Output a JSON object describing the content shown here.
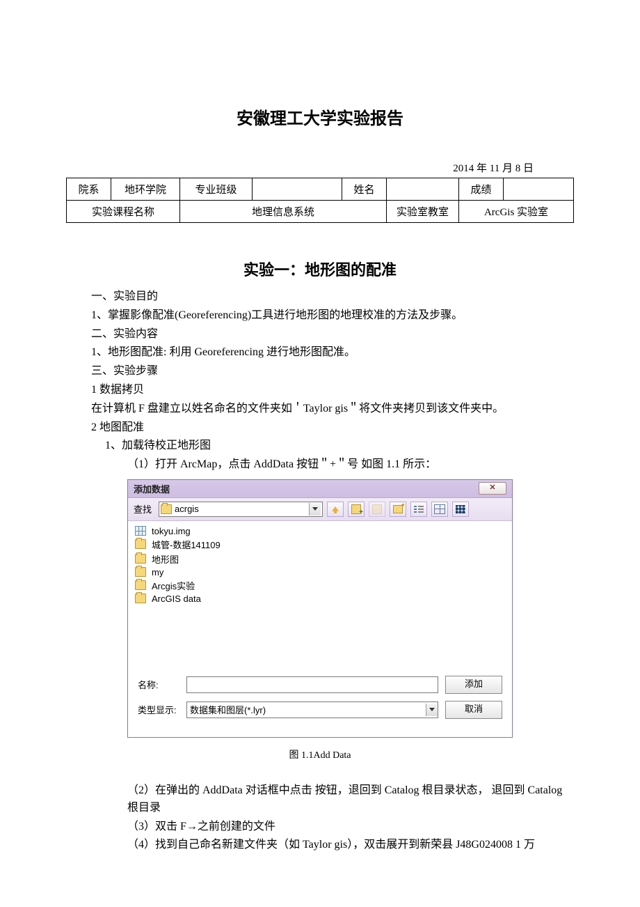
{
  "header": {
    "title": "安徽理工大学实验报告",
    "date": "2014 年 11 月 8 日"
  },
  "table": {
    "r1": {
      "c1": "院系",
      "c2": "地环学院",
      "c3": "专业班级",
      "c4": "",
      "c5": "姓名",
      "c6": "",
      "c7": "成绩",
      "c8": ""
    },
    "r2": {
      "c1": "实验课程名称",
      "c2": "地理信息系统",
      "c3": "实验室教室",
      "c4": "ArcGis 实验室"
    }
  },
  "exp": {
    "title": "实验一：地形图的配准",
    "s1h": "一、实验目的",
    "s1p1": "1、掌握影像配准(Georeferencing)工具进行地形图的地理校准的方法及步骤。",
    "s2h": "二、实验内容",
    "s2p1": "1、地形图配准: 利用 Georeferencing 进行地形图配准。",
    "s3h": "三、实验步骤",
    "s3p1": " 1 数据拷贝",
    "s3p2": "在计算机 F 盘建立以姓名命名的文件夹如＇Taylor gis＂将文件夹拷贝到该文件夹中。",
    "s3p3": " 2 地图配准",
    "s3p4": "1、加载待校正地形图",
    "s3p5": "（1）打开 ArcMap，点击 AddData 按钮＂+＂号 如图 1.1 所示：",
    "s3p6": "（2）在弹出的 AddData 对话框中点击 按钮，退回到 Catalog 根目录状态，  退回到 Catalog 根目录",
    "s3p7": "（3）双击 F→之前创建的文件",
    "s3p8": "（4）找到自己命名新建文件夹（如 Taylor gis），双击展开到新荣县 J48G024008 1 万"
  },
  "figcap": "图 1.1Add Data",
  "dialog": {
    "title": "添加数据",
    "lookin_label": "查找",
    "lookin_value": "acrgis",
    "items": {
      "i0": "tokyu.img",
      "i1": "城管-数据141109",
      "i2": "地形图",
      "i3": "my",
      "i4": "Arcgis实验",
      "i5": "ArcGIS data"
    },
    "name_label": "名称:",
    "name_value": "",
    "type_label": "类型显示:",
    "type_value": "数据集和图层(*.lyr)",
    "add_btn": "添加",
    "cancel_btn": "取消"
  }
}
